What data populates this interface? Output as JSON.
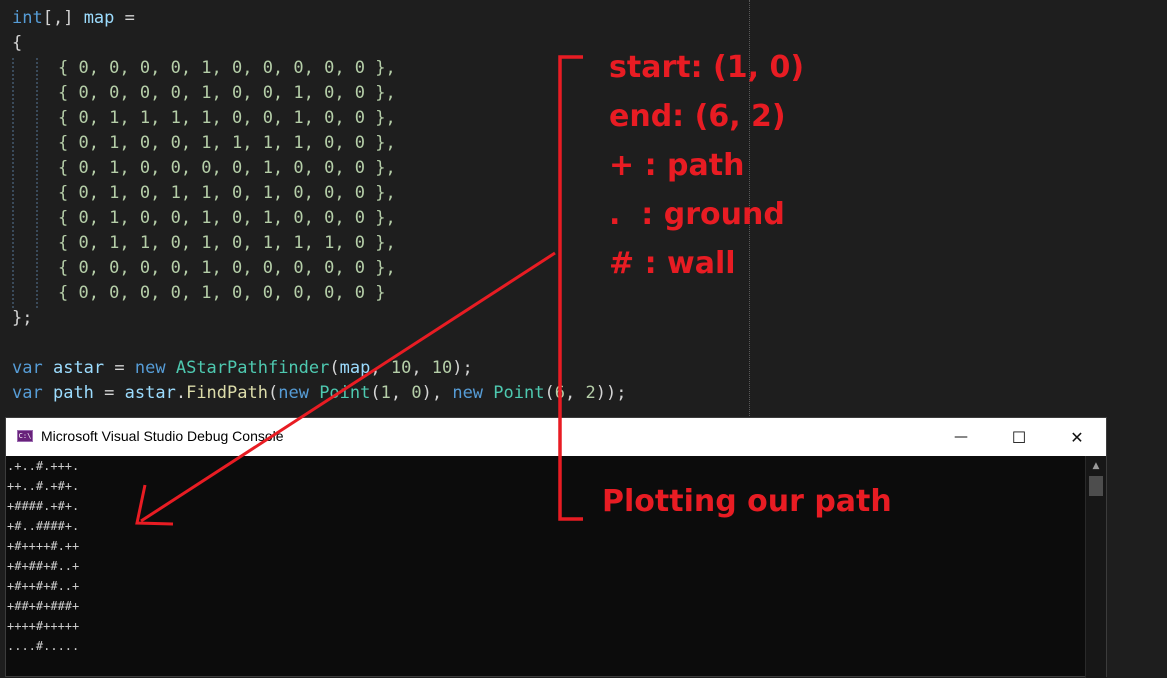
{
  "editor": {
    "declaration": {
      "type": "int",
      "brackets": "[,]",
      "name": "map",
      "op": " ="
    },
    "open_brace": "{",
    "grid_rows": [
      "{ 0, 0, 0, 0, 1, 0, 0, 0, 0, 0 },",
      "{ 0, 0, 0, 0, 1, 0, 0, 1, 0, 0 },",
      "{ 0, 1, 1, 1, 1, 0, 0, 1, 0, 0 },",
      "{ 0, 1, 0, 0, 1, 1, 1, 1, 0, 0 },",
      "{ 0, 1, 0, 0, 0, 0, 1, 0, 0, 0 },",
      "{ 0, 1, 0, 1, 1, 0, 1, 0, 0, 0 },",
      "{ 0, 1, 0, 0, 1, 0, 1, 0, 0, 0 },",
      "{ 0, 1, 1, 0, 1, 0, 1, 1, 1, 0 },",
      "{ 0, 0, 0, 0, 1, 0, 0, 0, 0, 0 },",
      "{ 0, 0, 0, 0, 1, 0, 0, 0, 0, 0 }"
    ],
    "close_brace": "};",
    "line_astar": {
      "kw_var": "var",
      "name": "astar",
      "eq": " = ",
      "kw_new": "new",
      "type": "AStarPathfinder",
      "args_open": "(",
      "arg_map": "map",
      "comma1": ", ",
      "n1": "10",
      "comma2": ", ",
      "n2": "10",
      "close": ");"
    },
    "line_path": {
      "kw_var": "var",
      "name": "path",
      "eq": " = ",
      "obj": "astar",
      "dot": ".",
      "method": "FindPath",
      "open": "(",
      "kw_new1": "new",
      "type1": "Point",
      "p1_open": "(",
      "p1a": "1",
      "p1c": ", ",
      "p1b": "0",
      "p1_close": "), ",
      "kw_new2": "new",
      "type2": "Point",
      "p2_open": "(",
      "p2a": "6",
      "p2c": ", ",
      "p2b": "2",
      "close": "));"
    }
  },
  "console": {
    "title": "Microsoft Visual Studio Debug Console",
    "icon": "console-app-icon",
    "icon_glyph": "C:\\",
    "controls": {
      "minimize": "—",
      "maximize": "☐",
      "close": "✕"
    },
    "scroll_up": "▲",
    "output": [
      ".+..#.+++.",
      "++..#.+#+.",
      "+####.+#+.",
      "+#..####+.",
      "+#++++#.++",
      "+#+##+#..+",
      "+#++#+#..+",
      "+##+#+###+",
      "++++#+++++",
      "....#....."
    ]
  },
  "annotations": {
    "legend": [
      "start: (1, 0)",
      "end: (6, 2)",
      "+ : path",
      ".  : ground",
      "# : wall"
    ],
    "caption": "Plotting our path",
    "color": "#e81c23"
  }
}
